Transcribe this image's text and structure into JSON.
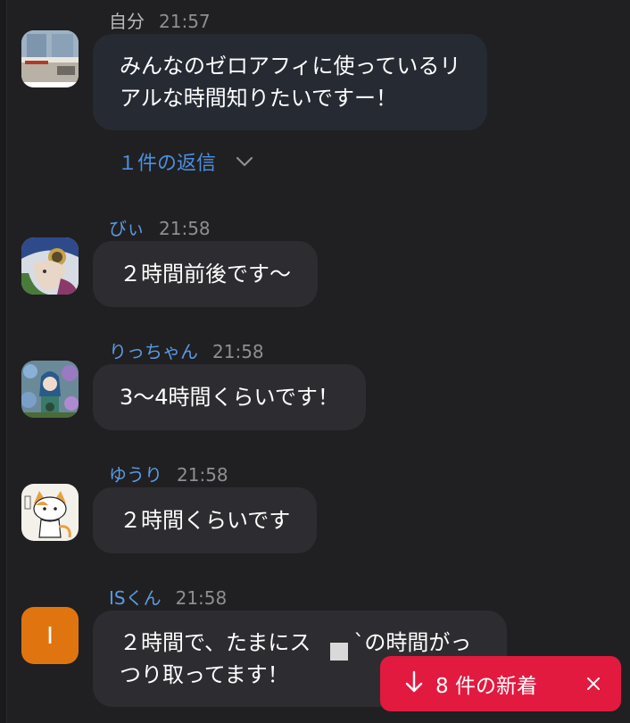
{
  "messages": [
    {
      "name": "自分",
      "time": "21:57",
      "lines": [
        "みんなのゼロアフィに使っているリ",
        "アルな時間知りたいですー！"
      ],
      "avatar_icon": "window-photo-avatar-icon",
      "replies_label": "１件の返信"
    },
    {
      "name": "びぃ",
      "time": "21:58",
      "lines": [
        "２時間前後です〜"
      ],
      "avatar_icon": "anime-character-avatar-icon"
    },
    {
      "name": "りっちゃん",
      "time": "21:58",
      "lines": [
        "3〜4時間くらいです！"
      ],
      "avatar_icon": "flower-garden-avatar-icon"
    },
    {
      "name": "ゆうり",
      "time": "21:58",
      "lines": [
        "２時間くらいです"
      ],
      "avatar_icon": "cartoon-cat-avatar-icon"
    },
    {
      "name": "ISくん",
      "time": "21:58",
      "lines": [
        "２時間で、たまにス　　`の時間がっ",
        "つり取ってます！"
      ],
      "avatar_initial": "I",
      "avatar_color": "#e0750f"
    }
  ],
  "new_messages_banner": {
    "label": "8 件の新着",
    "color": "#e21a3f",
    "arrow_icon": "arrow-down-icon",
    "close_icon": "close-icon"
  },
  "colors": {
    "background": "#202022",
    "bubble": "#2d2d31",
    "self_bubble": "#252a33",
    "name": "#5a9ae0",
    "link": "#4d8fde"
  }
}
